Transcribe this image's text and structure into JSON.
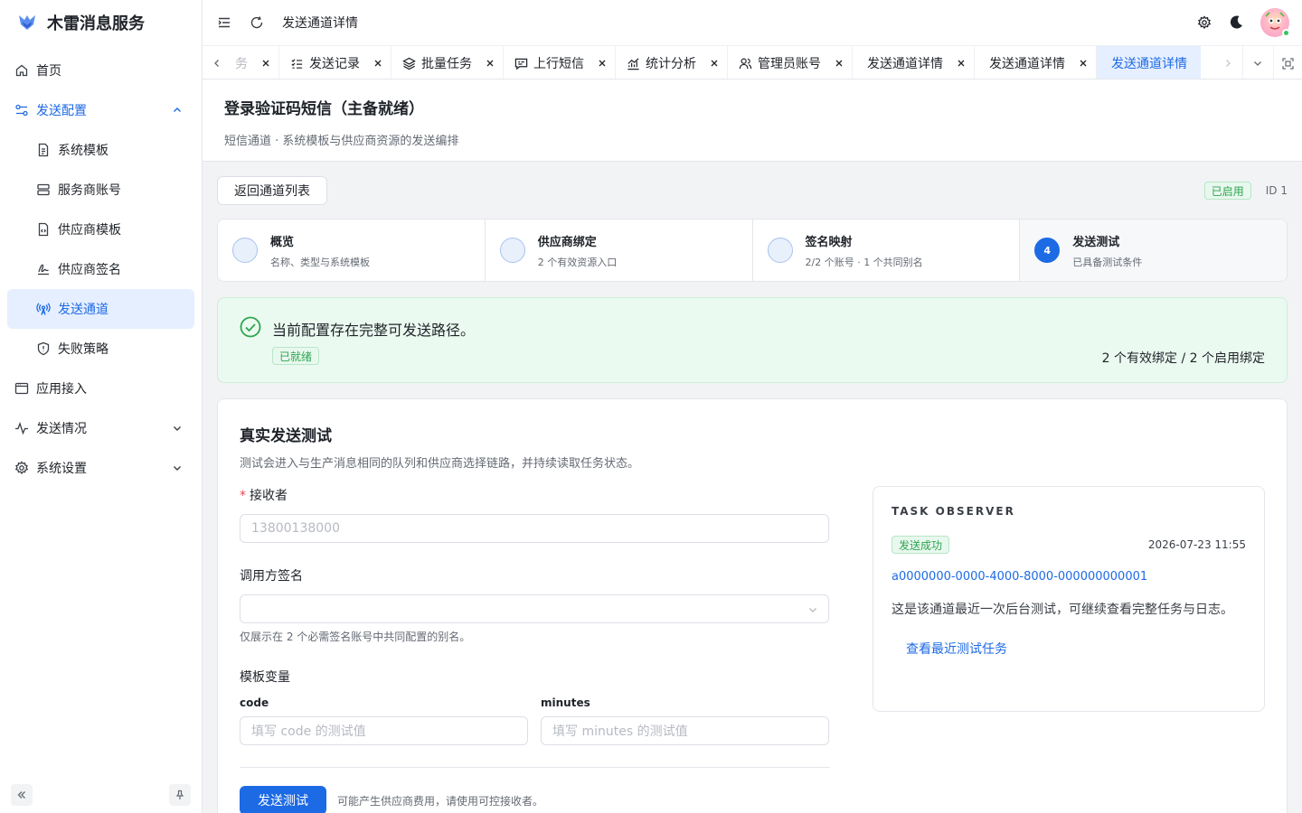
{
  "brand": {
    "name": "木雷消息服务",
    "accent": "#1d6ae5"
  },
  "sidebar": {
    "items": [
      {
        "label": "首页",
        "icon": "home-icon"
      },
      {
        "label": "发送配置",
        "icon": "settings-flow-icon",
        "expanded": true
      },
      {
        "label": "系统模板",
        "icon": "file-text-icon"
      },
      {
        "label": "服务商账号",
        "icon": "server-icon"
      },
      {
        "label": "供应商模板",
        "icon": "file-code-icon"
      },
      {
        "label": "供应商签名",
        "icon": "signature-icon"
      },
      {
        "label": "发送通道",
        "icon": "broadcast-icon",
        "active": true
      },
      {
        "label": "失败策略",
        "icon": "shield-icon"
      },
      {
        "label": "应用接入",
        "icon": "window-icon"
      },
      {
        "label": "发送情况",
        "icon": "activity-icon"
      },
      {
        "label": "系统设置",
        "icon": "gear-icon"
      }
    ]
  },
  "header": {
    "title": "发送通道详情"
  },
  "tabs": [
    {
      "label": "务",
      "icon": ""
    },
    {
      "label": "发送记录",
      "icon": "list-check-icon"
    },
    {
      "label": "批量任务",
      "icon": "layers-icon"
    },
    {
      "label": "上行短信",
      "icon": "message-icon"
    },
    {
      "label": "统计分析",
      "icon": "chart-icon"
    },
    {
      "label": "管理员账号",
      "icon": "users-icon"
    },
    {
      "label": "发送通道详情",
      "icon": ""
    },
    {
      "label": "发送通道详情",
      "icon": ""
    },
    {
      "label": "发送通道详情",
      "icon": "",
      "active": true
    }
  ],
  "page": {
    "title": "登录验证码短信（主备就绪）",
    "subtitle": "短信通道 · 系统模板与供应商资源的发送编排",
    "back_label": "返回通道列表",
    "status_tag": "已启用",
    "id_label": "ID 1"
  },
  "steps": [
    {
      "title": "概览",
      "desc": "名称、类型与系统模板",
      "number": ""
    },
    {
      "title": "供应商绑定",
      "desc": "2 个有效资源入口",
      "number": ""
    },
    {
      "title": "签名映射",
      "desc": "2/2 个账号 · 1 个共同别名",
      "number": ""
    },
    {
      "title": "发送测试",
      "desc": "已具备测试条件",
      "number": "4",
      "current": true
    }
  ],
  "alert": {
    "message": "当前配置存在完整可发送路径。",
    "tag": "已就绪",
    "summary": "2 个有效绑定 / 2 个启用绑定"
  },
  "test_card": {
    "title": "真实发送测试",
    "subtitle": "测试会进入与生产消息相同的队列和供应商选择链路，并持续读取任务状态。",
    "receiver_label": "接收者",
    "receiver_placeholder": "13800138000",
    "signature_label": "调用方签名",
    "signature_value": "",
    "signature_hint": "仅展示在 2 个必需签名账号中共同配置的别名。",
    "vars_label": "模板变量",
    "vars": [
      {
        "name": "code",
        "placeholder": "填写 code 的测试值"
      },
      {
        "name": "minutes",
        "placeholder": "填写 minutes 的测试值"
      }
    ],
    "submit_label": "发送测试",
    "submit_hint": "可能产生供应商费用，请使用可控接收者。"
  },
  "observer": {
    "title": "TASK OBSERVER",
    "status": "发送成功",
    "time": "2026-07-23 11:55",
    "task_id": "a0000000-0000-4000-8000-000000000001",
    "desc": "这是该通道最近一次后台测试，可继续查看完整任务与日志。",
    "link": "查看最近测试任务"
  }
}
